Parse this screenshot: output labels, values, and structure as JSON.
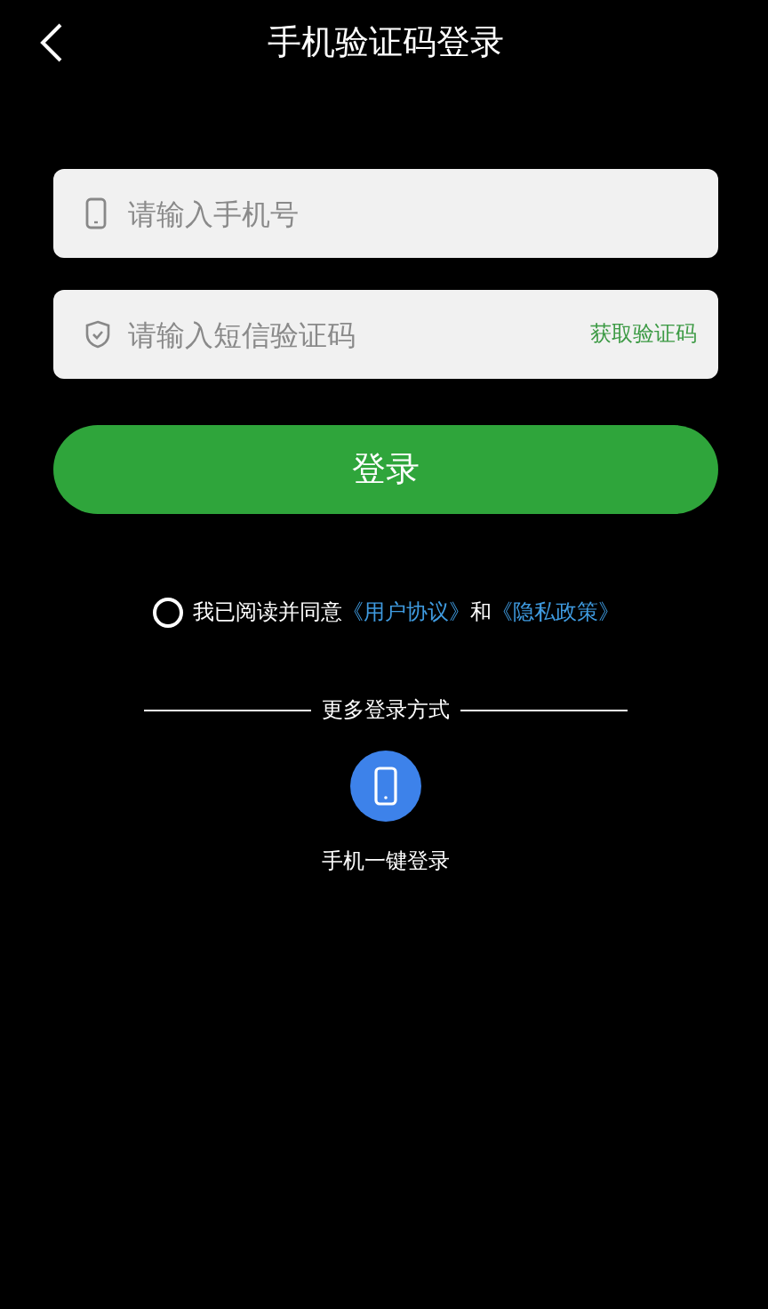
{
  "header": {
    "title": "手机验证码登录"
  },
  "phone_field": {
    "placeholder": "请输入手机号"
  },
  "code_field": {
    "placeholder": "请输入短信验证码",
    "action": "获取验证码"
  },
  "login_button": "登录",
  "agreement": {
    "checked": false,
    "prefix": "我已阅读并同意",
    "links": [
      "《用户协议》",
      "《隐私政策》"
    ],
    "joiner": "和"
  },
  "more_login": {
    "title": "更多登录方式",
    "options": [
      {
        "kind": "phone",
        "label": "手机一键登录"
      }
    ]
  }
}
